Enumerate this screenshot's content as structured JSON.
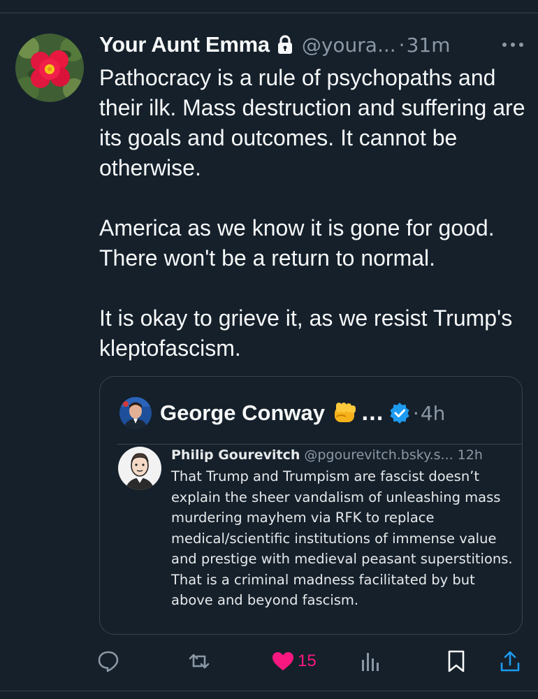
{
  "post": {
    "author_name": "Your Aunt Emma",
    "handle": "@youra...",
    "separator": "·",
    "time": "31m",
    "icons": {
      "lock": "lock-icon",
      "more": "more-icon",
      "avatar": "rose-avatar"
    },
    "paragraphs": [
      "Pathocracy is a rule of psychopaths and their ilk. Mass destruction and suffering are its goals and outcomes. It cannot be otherwise.",
      "America as we know it is gone for good. There won't be a return to normal.",
      "It is okay to grieve it, as we resist Trump's kleptofascism."
    ]
  },
  "quote": {
    "author_name": "George Conway",
    "emoji": "👊",
    "ellipsis": "...",
    "separator": "·",
    "time": "4h",
    "icons": {
      "fist": "fist-emoji-icon",
      "verified": "verified-badge-icon"
    },
    "nested": {
      "author_name": "Philip Gourevitch",
      "handle": "@pgourevitch.bsky.s...",
      "time": "12h",
      "text": "That Trump and Trumpism are fascist doesn’t explain the sheer vandalism of unleashing mass murdering mayhem via RFK to replace medical/scientific institutions of immense value and prestige with medieval peasant superstitions. That is a criminal madness facilitated by but above and beyond fascism."
    }
  },
  "actions": {
    "reply_icon": "reply-icon",
    "repost_icon": "repost-icon",
    "like_icon": "heart-icon",
    "like_count": "15",
    "views_icon": "views-icon",
    "bookmark_icon": "bookmark-icon",
    "share_icon": "share-icon"
  },
  "colors": {
    "background": "#15202b",
    "text": "#f7f9f9",
    "secondary": "#8b98a5",
    "divider": "#38444d",
    "like": "#f91880",
    "verified": "#1d9bf0"
  }
}
